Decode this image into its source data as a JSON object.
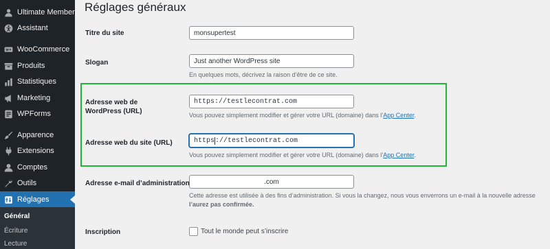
{
  "sidebar": {
    "items": [
      {
        "label": "Ultimate Member",
        "icon": "user-icon"
      },
      {
        "label": "Assistant",
        "icon": "accessibility-icon"
      },
      {
        "label": "WooCommerce",
        "icon": "woocommerce-icon"
      },
      {
        "label": "Produits",
        "icon": "archive-icon"
      },
      {
        "label": "Statistiques",
        "icon": "bar-chart-icon"
      },
      {
        "label": "Marketing",
        "icon": "megaphone-icon"
      },
      {
        "label": "WPForms",
        "icon": "forms-icon"
      },
      {
        "label": "Apparence",
        "icon": "paintbrush-icon"
      },
      {
        "label": "Extensions",
        "icon": "plugin-icon"
      },
      {
        "label": "Comptes",
        "icon": "users-icon"
      },
      {
        "label": "Outils",
        "icon": "wrench-icon"
      },
      {
        "label": "Réglages",
        "icon": "settings-icon"
      }
    ],
    "submenu": [
      "Général",
      "Écriture",
      "Lecture"
    ]
  },
  "page": {
    "title": "Réglages généraux"
  },
  "fields": {
    "site_title": {
      "label": "Titre du site",
      "value": "monsupertest"
    },
    "tagline": {
      "label": "Slogan",
      "value": "Just another WordPress site",
      "desc": "En quelques mots, décrivez la raison d’être de ce site."
    },
    "wp_url": {
      "label": "Adresse web de WordPress (URL)",
      "value": "https://testlecontrat.com",
      "desc_prefix": "Vous pouvez simplement modifier et gérer votre URL (domaine) dans l’",
      "desc_link": "App Center",
      "desc_suffix": "."
    },
    "site_url": {
      "label": "Adresse web du site (URL)",
      "value_before_cursor": "https",
      "value_after_cursor": "://testlecontrat.com",
      "desc_prefix": "Vous pouvez simplement modifier et gérer votre URL (domaine) dans l’",
      "desc_link": "App Center",
      "desc_suffix": "."
    },
    "admin_email": {
      "label": "Adresse e-mail d’administration",
      "value": ".com",
      "desc_line1": "Cette adresse est utilisée à des fins d’administration. Si vous la changez, nous vous enverrons un e-mail à la nouvelle adresse",
      "desc_line2": "l’aurez pas confirmée."
    },
    "membership": {
      "label": "Inscription",
      "checkbox_label": "Tout le monde peut s’inscrire"
    }
  },
  "colors": {
    "accent": "#2271b1",
    "sidebar_bg": "#1d2327",
    "highlight": "#22b33a"
  }
}
